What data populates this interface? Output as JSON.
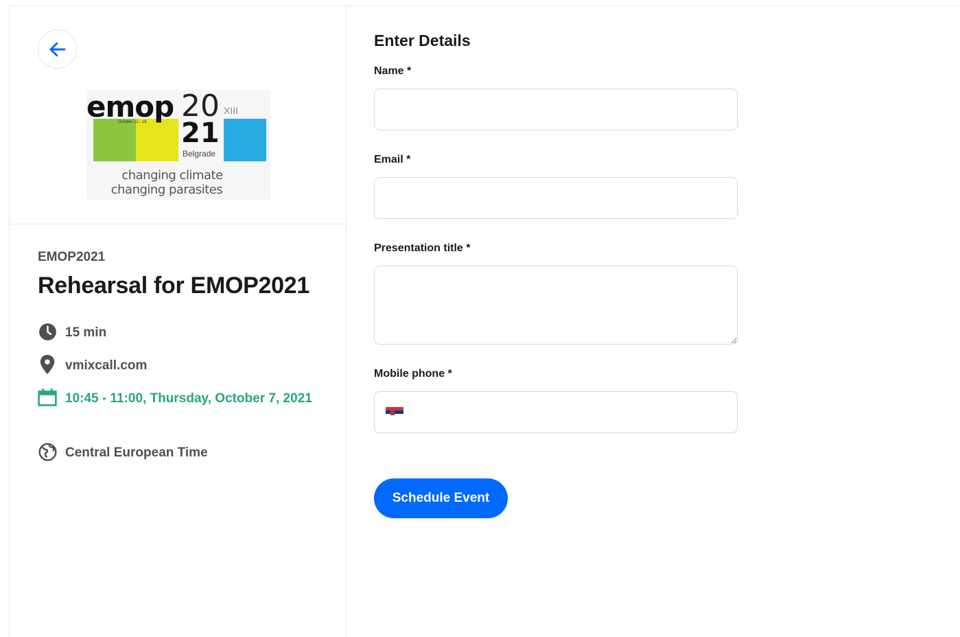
{
  "left_panel": {
    "back_button_icon": "arrow-left-icon",
    "logo": {
      "line1": "emop",
      "line2": "20",
      "line3": "21",
      "roman": "XIII",
      "dates": "October 12 - 16",
      "city": "Belgrade",
      "tagline1": "changing climate",
      "tagline2": "changing parasites",
      "colors": [
        "#8cc63f",
        "#e5e51a",
        "#29abe2"
      ]
    },
    "organizer": "EMOP2021",
    "event_title": "Rehearsal for EMOP2021",
    "details": {
      "duration": "15 min",
      "location": "vmixcall.com",
      "datetime": "10:45 - 11:00, Thursday, October 7, 2021",
      "timezone": "Central European Time"
    },
    "accent_green": "#26a875"
  },
  "form": {
    "heading": "Enter Details",
    "name_label": "Name *",
    "email_label": "Email *",
    "presentation_label": "Presentation title *",
    "phone_label": "Mobile phone *",
    "phone_country_flag": "serbia-flag-icon",
    "submit_label": "Schedule Event",
    "accent_blue": "#0069ff"
  }
}
